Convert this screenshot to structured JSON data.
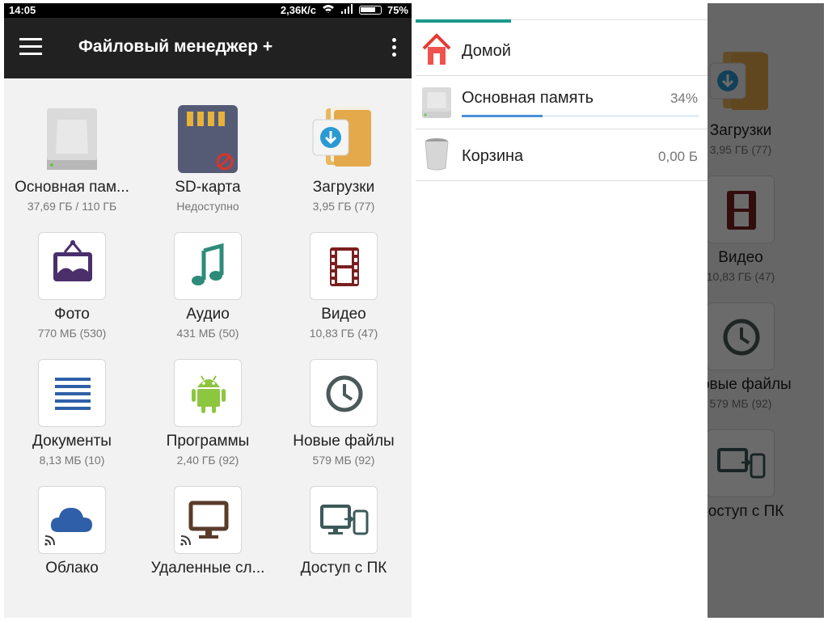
{
  "status": {
    "time": "14:05",
    "speed": "2,36К/с",
    "battery": "75%"
  },
  "appbar": {
    "title": "Файловый менеджер +"
  },
  "grid": [
    {
      "name": "Основная пам...",
      "sub": "37,69 ГБ / 110 ГБ",
      "icon": "hard-drive-icon"
    },
    {
      "name": "SD-карта",
      "sub": "Недоступно",
      "icon": "sd-card-icon"
    },
    {
      "name": "Загрузки",
      "sub": "3,95 ГБ (77)",
      "icon": "downloads-folder-icon"
    },
    {
      "name": "Фото",
      "sub": "770 МБ (530)",
      "icon": "photo-icon"
    },
    {
      "name": "Аудио",
      "sub": "431 МБ (50)",
      "icon": "music-note-icon"
    },
    {
      "name": "Видео",
      "sub": "10,83 ГБ (47)",
      "icon": "film-icon"
    },
    {
      "name": "Документы",
      "sub": "8,13 МБ (10)",
      "icon": "document-icon"
    },
    {
      "name": "Программы",
      "sub": "2,40 ГБ (92)",
      "icon": "android-icon"
    },
    {
      "name": "Новые файлы",
      "sub": "579 МБ (92)",
      "icon": "clock-icon"
    },
    {
      "name": "Облако",
      "sub": "",
      "icon": "cloud-icon"
    },
    {
      "name": "Удаленные сл...",
      "sub": "",
      "icon": "monitor-icon"
    },
    {
      "name": "Доступ с ПК",
      "sub": "",
      "icon": "pc-access-icon"
    }
  ],
  "drawer": {
    "items": [
      {
        "label": "Домой",
        "value": "",
        "icon": "home-icon"
      },
      {
        "label": "Основная память",
        "value": "34%",
        "icon": "hard-drive-icon",
        "progress": 0.34
      },
      {
        "label": "Корзина",
        "value": "0,00 Б",
        "icon": "trash-icon"
      }
    ]
  },
  "colors": {
    "appbar": "#212121",
    "accent": "#1b998b",
    "progress": "#4a90d9",
    "photo": "#4a2f6b",
    "audio": "#2e8b7a",
    "video": "#7a1f1f",
    "docs": "#2f5fa8",
    "android": "#8dc63f",
    "clock": "#4a5a58",
    "cloud": "#2f5fa8"
  }
}
